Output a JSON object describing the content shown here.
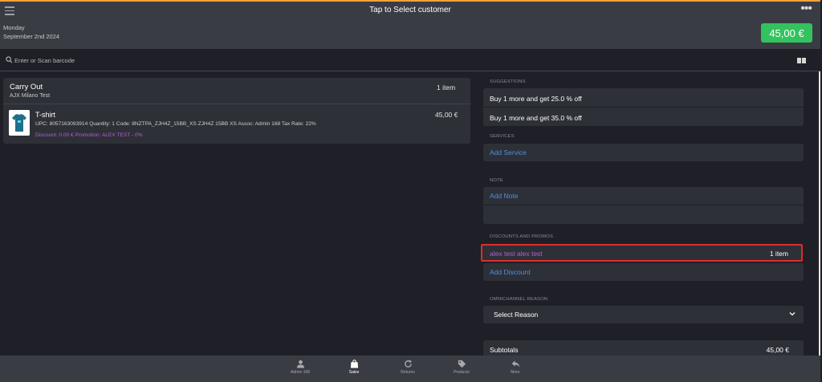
{
  "header": {
    "title": "Tap to Select customer",
    "day": "Monday",
    "date": "September 2nd 2024",
    "total": "45,00 €",
    "more_label": "•••"
  },
  "search": {
    "placeholder": "Enter or Scan barcode"
  },
  "cart": {
    "order_type": "Carry Out",
    "store": "AJX Milano Test",
    "item_count": "1 item",
    "items": [
      {
        "name": "T-shirt",
        "details": "UPC: 8057163093914 Quantity: 1 Code: 8NZTPA_ZJH4Z_15BB_XS ZJH4Z 15BB XS Assoc: Admin 168 Tax Rate: 22%",
        "promo": "Discount: 0.00 € Promotion: ALEX TEST - 0%",
        "price": "45,00 €"
      }
    ]
  },
  "right_panel": {
    "suggestions_label": "SUGGESTIONS",
    "suggestions": [
      "Buy 1 more and get 25.0 % off",
      "Buy 1 more and get 35.0 % off"
    ],
    "services_label": "SERVICES",
    "add_service": "Add Service",
    "note_label": "NOTE",
    "add_note": "Add Note",
    "discounts_label": "DISCOUNTS AND PROMOS",
    "promo_name": "alex test alex test",
    "promo_count": "1 item",
    "add_discount": "Add Discount",
    "omnichannel_label": "OMNICHANNEL REASON",
    "select_reason": "Select Reason",
    "subtotals_label": "Subtotals",
    "subtotals_value": "45,00 €"
  },
  "tabs": [
    {
      "label": "Admin 168",
      "icon": "person-icon"
    },
    {
      "label": "Sales",
      "icon": "bag-icon"
    },
    {
      "label": "Returns",
      "icon": "refresh-icon"
    },
    {
      "label": "Products",
      "icon": "tags-icon"
    },
    {
      "label": "More",
      "icon": "reply-icon"
    }
  ],
  "colors": {
    "accent_top": "#f1a33a",
    "total_button": "#33c35e",
    "link": "#4a90e2",
    "promo_text": "#b35ed6",
    "highlight_border": "#e02c2c"
  }
}
